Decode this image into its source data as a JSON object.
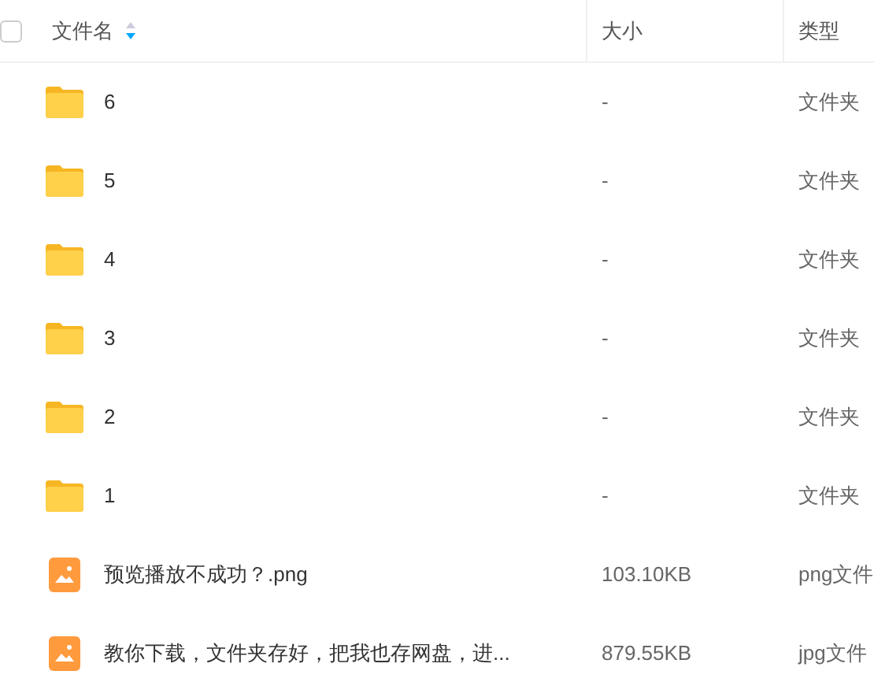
{
  "header": {
    "select_all": {
      "checked": false
    },
    "columns": [
      {
        "label": "文件名",
        "sort_descending": true
      },
      {
        "label": "大小"
      },
      {
        "label": "类型"
      }
    ]
  },
  "rows": [
    {
      "kind": "folder",
      "name": "6",
      "size": "-",
      "type": "文件夹"
    },
    {
      "kind": "folder",
      "name": "5",
      "size": "-",
      "type": "文件夹"
    },
    {
      "kind": "folder",
      "name": "4",
      "size": "-",
      "type": "文件夹"
    },
    {
      "kind": "folder",
      "name": "3",
      "size": "-",
      "type": "文件夹"
    },
    {
      "kind": "folder",
      "name": "2",
      "size": "-",
      "type": "文件夹"
    },
    {
      "kind": "folder",
      "name": "1",
      "size": "-",
      "type": "文件夹"
    },
    {
      "kind": "image",
      "name": "预览播放不成功？.png",
      "size": "103.10KB",
      "type": "png文件"
    },
    {
      "kind": "image",
      "name": "教你下载，文件夹存好，把我也存网盘，进...",
      "size": "879.55KB",
      "type": "jpg文件"
    }
  ]
}
